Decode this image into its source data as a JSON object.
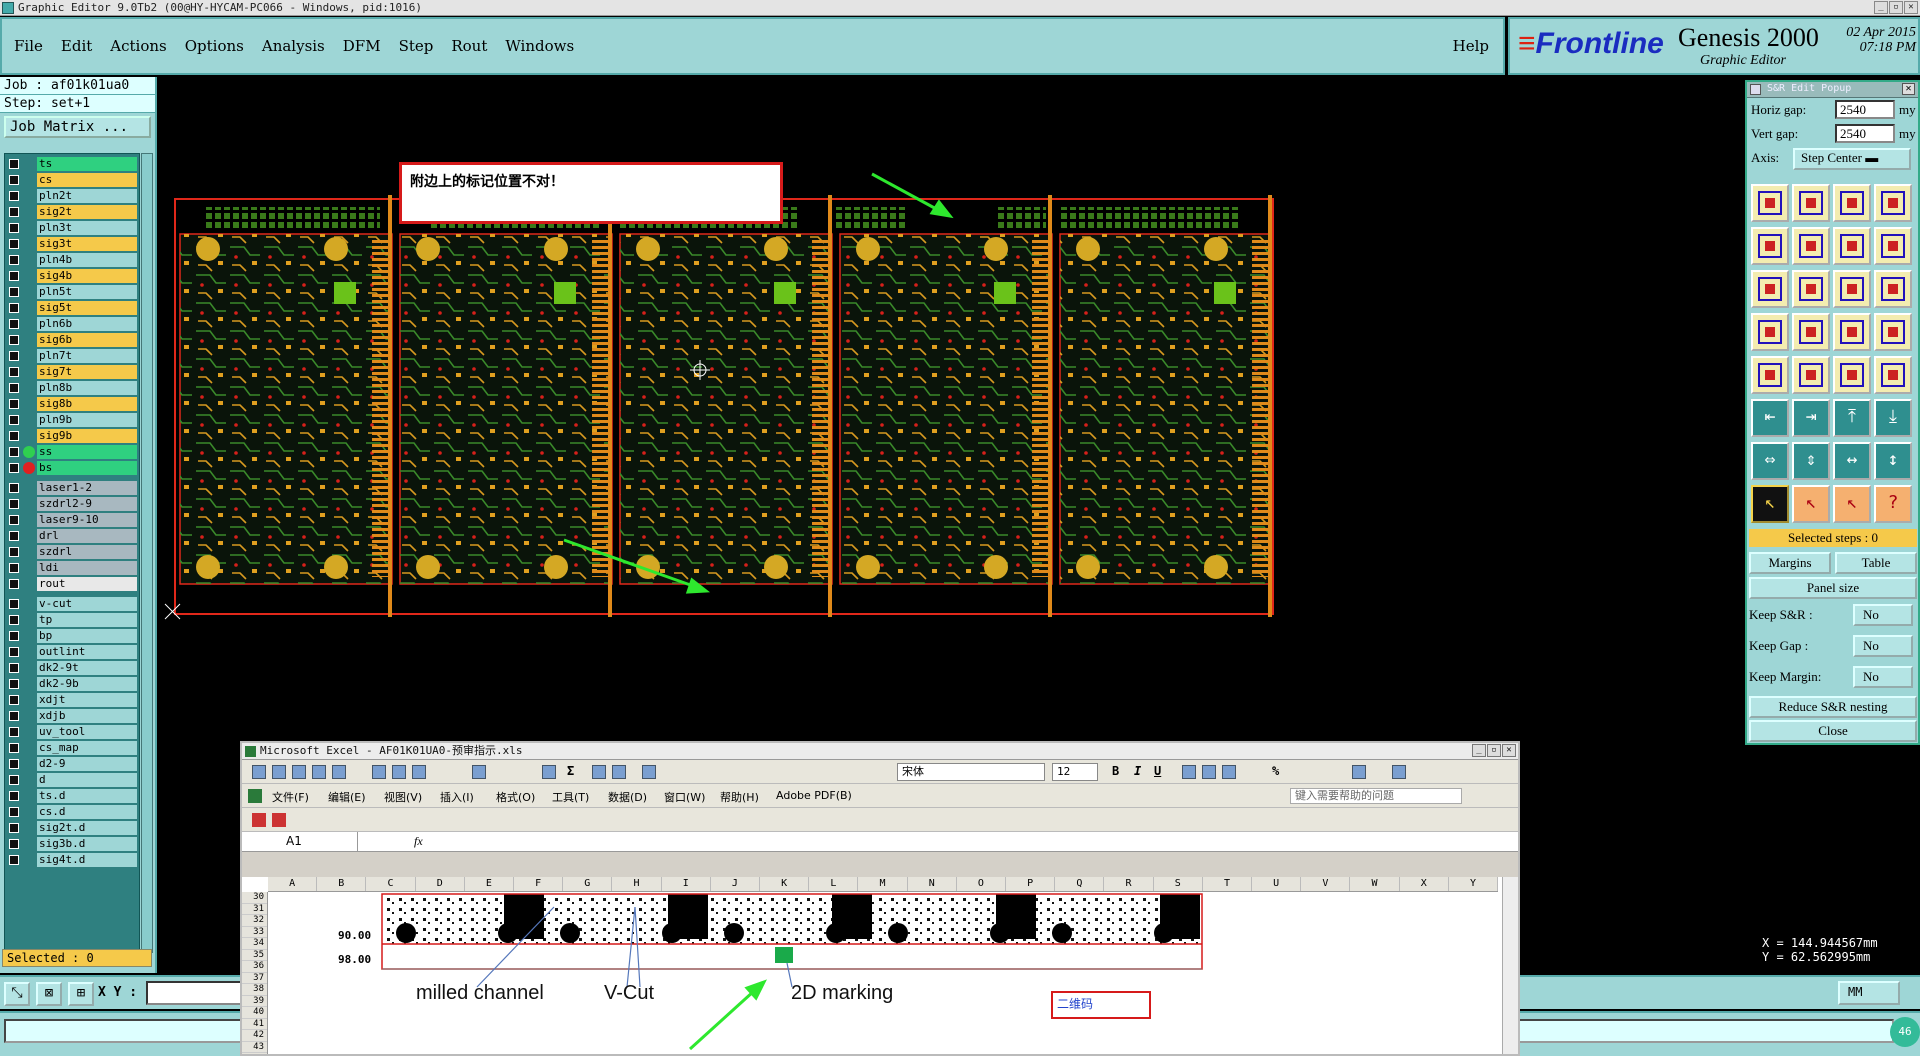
{
  "window": {
    "title": "Graphic Editor 9.0Tb2 (00@HY-HYCAM-PC066 - Windows, pid:1016)"
  },
  "menu": {
    "items": [
      "File",
      "Edit",
      "Actions",
      "Options",
      "Analysis",
      "DFM",
      "Step",
      "Rout",
      "Windows"
    ],
    "help": "Help"
  },
  "brand": {
    "logo": "Frontline",
    "product": "Genesis 2000",
    "subtitle": "Graphic Editor",
    "date": "02 Apr 2015",
    "time": "07:18 PM"
  },
  "left_panel": {
    "job": "Job : af01k01ua0",
    "step": "Step: set+1",
    "job_matrix": "Job Matrix ...",
    "selected": "Selected : 0",
    "layers": [
      {
        "name": "ts",
        "color": "#2fd080",
        "indicator": ""
      },
      {
        "name": "cs",
        "color": "#f5c94a",
        "indicator": ""
      },
      {
        "name": "pln2t",
        "color": "#9ed6d6",
        "indicator": ""
      },
      {
        "name": "sig2t",
        "color": "#f5c94a",
        "indicator": ""
      },
      {
        "name": "pln3t",
        "color": "#9ed6d6",
        "indicator": ""
      },
      {
        "name": "sig3t",
        "color": "#f5c94a",
        "indicator": ""
      },
      {
        "name": "pln4b",
        "color": "#9ed6d6",
        "indicator": ""
      },
      {
        "name": "sig4b",
        "color": "#f5c94a",
        "indicator": ""
      },
      {
        "name": "pln5t",
        "color": "#9ed6d6",
        "indicator": ""
      },
      {
        "name": "sig5t",
        "color": "#f5c94a",
        "indicator": ""
      },
      {
        "name": "pln6b",
        "color": "#9ed6d6",
        "indicator": ""
      },
      {
        "name": "sig6b",
        "color": "#f5c94a",
        "indicator": ""
      },
      {
        "name": "pln7t",
        "color": "#9ed6d6",
        "indicator": ""
      },
      {
        "name": "sig7t",
        "color": "#f5c94a",
        "indicator": ""
      },
      {
        "name": "pln8b",
        "color": "#9ed6d6",
        "indicator": ""
      },
      {
        "name": "sig8b",
        "color": "#f5c94a",
        "indicator": ""
      },
      {
        "name": "pln9b",
        "color": "#9ed6d6",
        "indicator": ""
      },
      {
        "name": "sig9b",
        "color": "#f5c94a",
        "indicator": ""
      },
      {
        "name": "ss",
        "color": "#2fd080",
        "indicator": "green"
      },
      {
        "name": "bs",
        "color": "#2fd080",
        "indicator": "red"
      },
      {
        "name": "laser1-2",
        "color": "#a8b8c0",
        "indicator": "",
        "sep": true
      },
      {
        "name": "szdrl2-9",
        "color": "#a8b8c0",
        "indicator": ""
      },
      {
        "name": "laser9-10",
        "color": "#a8b8c0",
        "indicator": ""
      },
      {
        "name": "drl",
        "color": "#a8b8c0",
        "indicator": ""
      },
      {
        "name": "szdrl",
        "color": "#a8b8c0",
        "indicator": ""
      },
      {
        "name": "ldi",
        "color": "#a8b8c0",
        "indicator": ""
      },
      {
        "name": "rout",
        "color": "#e8e8e8",
        "indicator": ""
      },
      {
        "name": "v-cut",
        "color": "#9ed6d6",
        "indicator": "",
        "sep": true
      },
      {
        "name": "tp",
        "color": "#9ed6d6",
        "indicator": ""
      },
      {
        "name": "bp",
        "color": "#9ed6d6",
        "indicator": ""
      },
      {
        "name": "outlint",
        "color": "#9ed6d6",
        "indicator": ""
      },
      {
        "name": "dk2-9t",
        "color": "#9ed6d6",
        "indicator": ""
      },
      {
        "name": "dk2-9b",
        "color": "#9ed6d6",
        "indicator": ""
      },
      {
        "name": "xdjt",
        "color": "#9ed6d6",
        "indicator": ""
      },
      {
        "name": "xdjb",
        "color": "#9ed6d6",
        "indicator": ""
      },
      {
        "name": "uv_tool",
        "color": "#9ed6d6",
        "indicator": ""
      },
      {
        "name": "cs_map",
        "color": "#9ed6d6",
        "indicator": ""
      },
      {
        "name": "d2-9",
        "color": "#9ed6d6",
        "indicator": ""
      },
      {
        "name": "d",
        "color": "#9ed6d6",
        "indicator": ""
      },
      {
        "name": "ts.d",
        "color": "#9ed6d6",
        "indicator": ""
      },
      {
        "name": "cs.d",
        "color": "#9ed6d6",
        "indicator": ""
      },
      {
        "name": "sig2t.d",
        "color": "#9ed6d6",
        "indicator": ""
      },
      {
        "name": "sig3b.d",
        "color": "#9ed6d6",
        "indicator": ""
      },
      {
        "name": "sig4t.d",
        "color": "#9ed6d6",
        "indicator": ""
      }
    ]
  },
  "canvas": {
    "note": "附边上的标记位置不对！"
  },
  "sr_popup": {
    "title": "S&R Edit Popup",
    "horiz_label": "Horiz gap:",
    "horiz_value": "2540",
    "vert_label": "Vert  gap:",
    "vert_value": "2540",
    "unit": "my",
    "axis_label": "Axis:",
    "axis_value": "Step Center",
    "selected_steps": "Selected steps : 0",
    "margins": "Margins",
    "table": "Table",
    "panel_size": "Panel size",
    "keep_sr": "Keep S&R   :",
    "keep_gap": "Keep Gap    :",
    "keep_margin": "Keep Margin:",
    "no": "No",
    "reduce": "Reduce S&R nesting",
    "close": "Close"
  },
  "coords": {
    "x": "X  =  144.944567mm",
    "y": "Y  =  62.562995mm"
  },
  "bottom": {
    "xy_label": "X Y :",
    "units": "MM",
    "badge": "46"
  },
  "excel": {
    "title": "Microsoft Excel - AF01K01UA0-预审指示.xls",
    "font_name": "宋体",
    "font_size": "12",
    "menu": [
      "文件(F)",
      "编辑(E)",
      "视图(V)",
      "插入(I)",
      "格式(O)",
      "工具(T)",
      "数据(D)",
      "窗口(W)",
      "帮助(H)",
      "Adobe PDF(B)"
    ],
    "help_placeholder": "键入需要帮助的问题",
    "cell_ref": "A1",
    "fx": "fx",
    "columns": [
      "A",
      "B",
      "C",
      "D",
      "E",
      "F",
      "G",
      "H",
      "I",
      "J",
      "K",
      "L",
      "M",
      "N",
      "O",
      "P",
      "Q",
      "R",
      "S",
      "T",
      "U",
      "V",
      "W",
      "X",
      "Y"
    ],
    "rows": [
      "30",
      "31",
      "32",
      "33",
      "34",
      "35",
      "36",
      "37",
      "38",
      "39",
      "40",
      "41",
      "42",
      "43"
    ],
    "dim1": "90.00",
    "dim2": "98.00",
    "label_milled": "milled channel",
    "label_vcut": "V-Cut",
    "label_2d": "2D marking",
    "qr_label": "二维码"
  }
}
